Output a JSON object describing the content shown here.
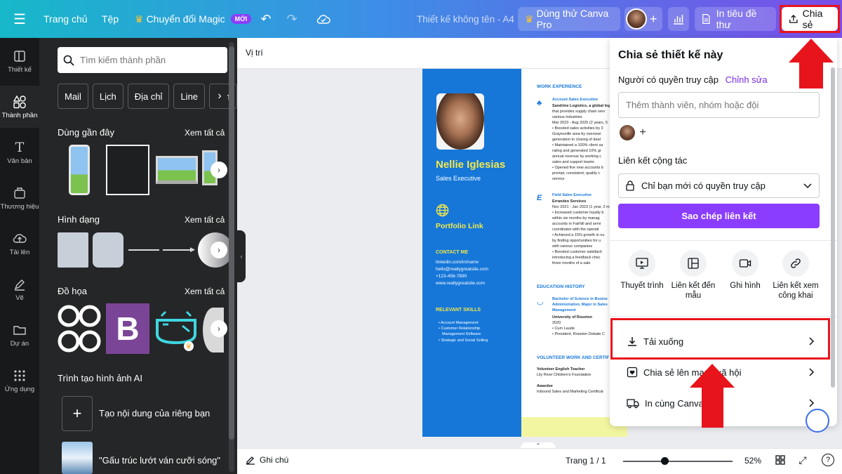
{
  "topbar": {
    "home": "Trang chủ",
    "file": "Tệp",
    "magic": "Chuyển đổi Magic",
    "new_badge": "MỚI",
    "doc_title": "Thiết kế không tên - A4",
    "try_pro": "Dùng thử Canva Pro",
    "print_letterhead": "In tiêu đề thư",
    "share": "Chia sẻ"
  },
  "rail": {
    "items": [
      {
        "label": "Thiết kế"
      },
      {
        "label": "Thành phần"
      },
      {
        "label": "Văn bản"
      },
      {
        "label": "Thương hiệu"
      },
      {
        "label": "Tải lên"
      },
      {
        "label": "Vẽ"
      },
      {
        "label": "Dự án"
      },
      {
        "label": "Ứng dụng"
      }
    ]
  },
  "panel": {
    "search_placeholder": "Tìm kiếm thành phần",
    "chips": [
      "Mail",
      "Lịch",
      "Địa chỉ",
      "Line",
      "Em"
    ],
    "recent": "Dùng gần đây",
    "shapes": "Hình dạng",
    "graphics": "Đồ họa",
    "see_all": "Xem tất cả",
    "ai_title": "Trình tạo hình ảnh AI",
    "ai_create": "Tạo nội dung của riêng bạn",
    "ai_sample": "\"Gấu trúc lướt ván cưỡi sóng\""
  },
  "canvas": {
    "position_label": "Vị trí"
  },
  "resume": {
    "name": "Nellie Iglesias",
    "role": "Sales Executive",
    "portfolio": "Portfolio Link",
    "contact_h": "CONTACT ME",
    "contact": [
      "linkedin.com/in/name",
      "hello@reallygreatsite.com",
      "+123-456-7890",
      "www.reallygreatsite.com"
    ],
    "skills_h": "RELEVANT SKILLS",
    "skills": [
      "Account Management",
      "Customer Relationship",
      "Management Software",
      "Strategic and Social Selling"
    ],
    "work_h": "WORK EXPERIENCE",
    "job1_title": "Account Sales Executive",
    "job1_lines": [
      "Sandrine Logistics, a global log",
      "that provides supply chain serv",
      "various industries",
      "Mar 2023 - Aug 2025 (2 years, 5",
      "• Boosted sales activities by 3",
      "Grayesville area by overseei",
      "generation to closing of deal",
      "• Maintained a 100% client sa",
      "rating and generated 10% gr",
      "annual revenue by working c",
      "sales and support teams",
      "• Opened five new accounts b",
      "prompt, consistent, quality c",
      "service"
    ],
    "job2_title": "Field Sales Executive",
    "job2_lines": [
      "Errandeo Services",
      "Nov 2021 - Jan 2023 (1 year, 2 m",
      "• Increased customer loyalty b",
      "within six months by manag",
      "accounts in Fairhill and servi",
      "coordinator with the operati",
      "• Achieved a 15% growth in ou",
      "by finding opportunities for u",
      "with various companies",
      "• Boosted customer satisfacti",
      "introducing a feedback chec",
      "three months of a sale"
    ],
    "edu_h": "EDUCATION HISTORY",
    "edu_title": "Bachelor of Science in Busine",
    "edu_lines": [
      "Administration, Major in Sales",
      "Management"
    ],
    "edu_detail": [
      "University of Roseton",
      "2020",
      "• Cum Laude",
      "• President, Roseton Debate C"
    ],
    "vol_h": "VOLUNTEER WORK AND CERTIF",
    "vol_lines": [
      "Volunteer English Teacher",
      "Lily River Children's Foundation",
      "",
      "Awardee",
      "Inbound Sales and Marketing Certificat"
    ]
  },
  "share": {
    "title": "Chia sẻ thiết kế này",
    "access_label": "Người có quyền truy cập",
    "edit_link": "Chỉnh sửa",
    "invite_placeholder": "Thêm thành viên, nhóm hoặc đội",
    "collab_label": "Liên kết cộng tác",
    "collab_value": "Chỉ bạn mới có quyền truy cập",
    "copy_button": "Sao chép liên kết",
    "options": [
      {
        "label": "Thuyết trình",
        "icon": "present-icon"
      },
      {
        "label": "Liên kết đến mẫu",
        "icon": "template-link-icon"
      },
      {
        "label": "Ghi hình",
        "icon": "record-icon"
      },
      {
        "label": "Liên kết xem công khai",
        "icon": "public-link-icon"
      }
    ],
    "download": "Tải xuống",
    "social": "Chia sẻ lên mạng xã hội",
    "print": "In cùng Canva"
  },
  "bottombar": {
    "notes": "Ghi chú",
    "page": "Trang 1 / 1",
    "zoom": "52%",
    "zoom_value": 0.38
  },
  "colors": {
    "accent": "#8b3dff",
    "highlight": "#e8141c",
    "resume_blue": "#1677d9",
    "resume_yellow": "#f3e84a"
  }
}
